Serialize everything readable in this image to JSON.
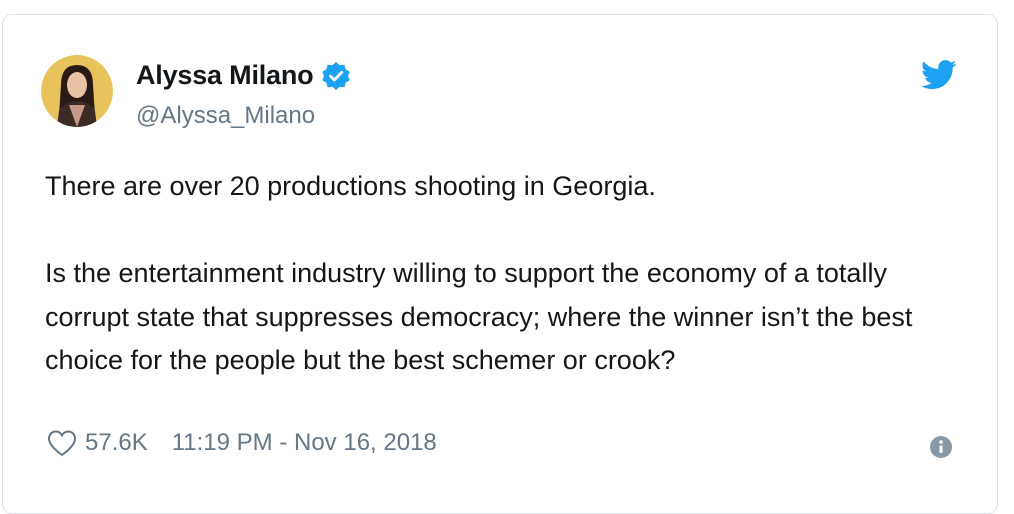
{
  "tweet": {
    "author": {
      "display_name": "Alyssa Milano",
      "handle": "@Alyssa_Milano",
      "verified": true
    },
    "text": "There are over 20 productions shooting in Georgia.\n\nIs the entertainment industry willing to support the economy of a totally corrupt state that suppresses democracy; where the winner isn’t the best choice for the people but the best schemer or crook?",
    "like_count": "57.6K",
    "timestamp": "11:19 PM - Nov 16, 2018"
  },
  "icons": {
    "verified": "verified-badge-icon",
    "brand": "twitter-bird-icon",
    "like": "heart-icon",
    "info": "info-icon",
    "avatar": "avatar-photo"
  },
  "colors": {
    "accent": "#1da1f2",
    "text_primary": "#14171a",
    "text_secondary": "#657786",
    "border": "#dfe3e8",
    "avatar_bg": "#e8c25a"
  }
}
